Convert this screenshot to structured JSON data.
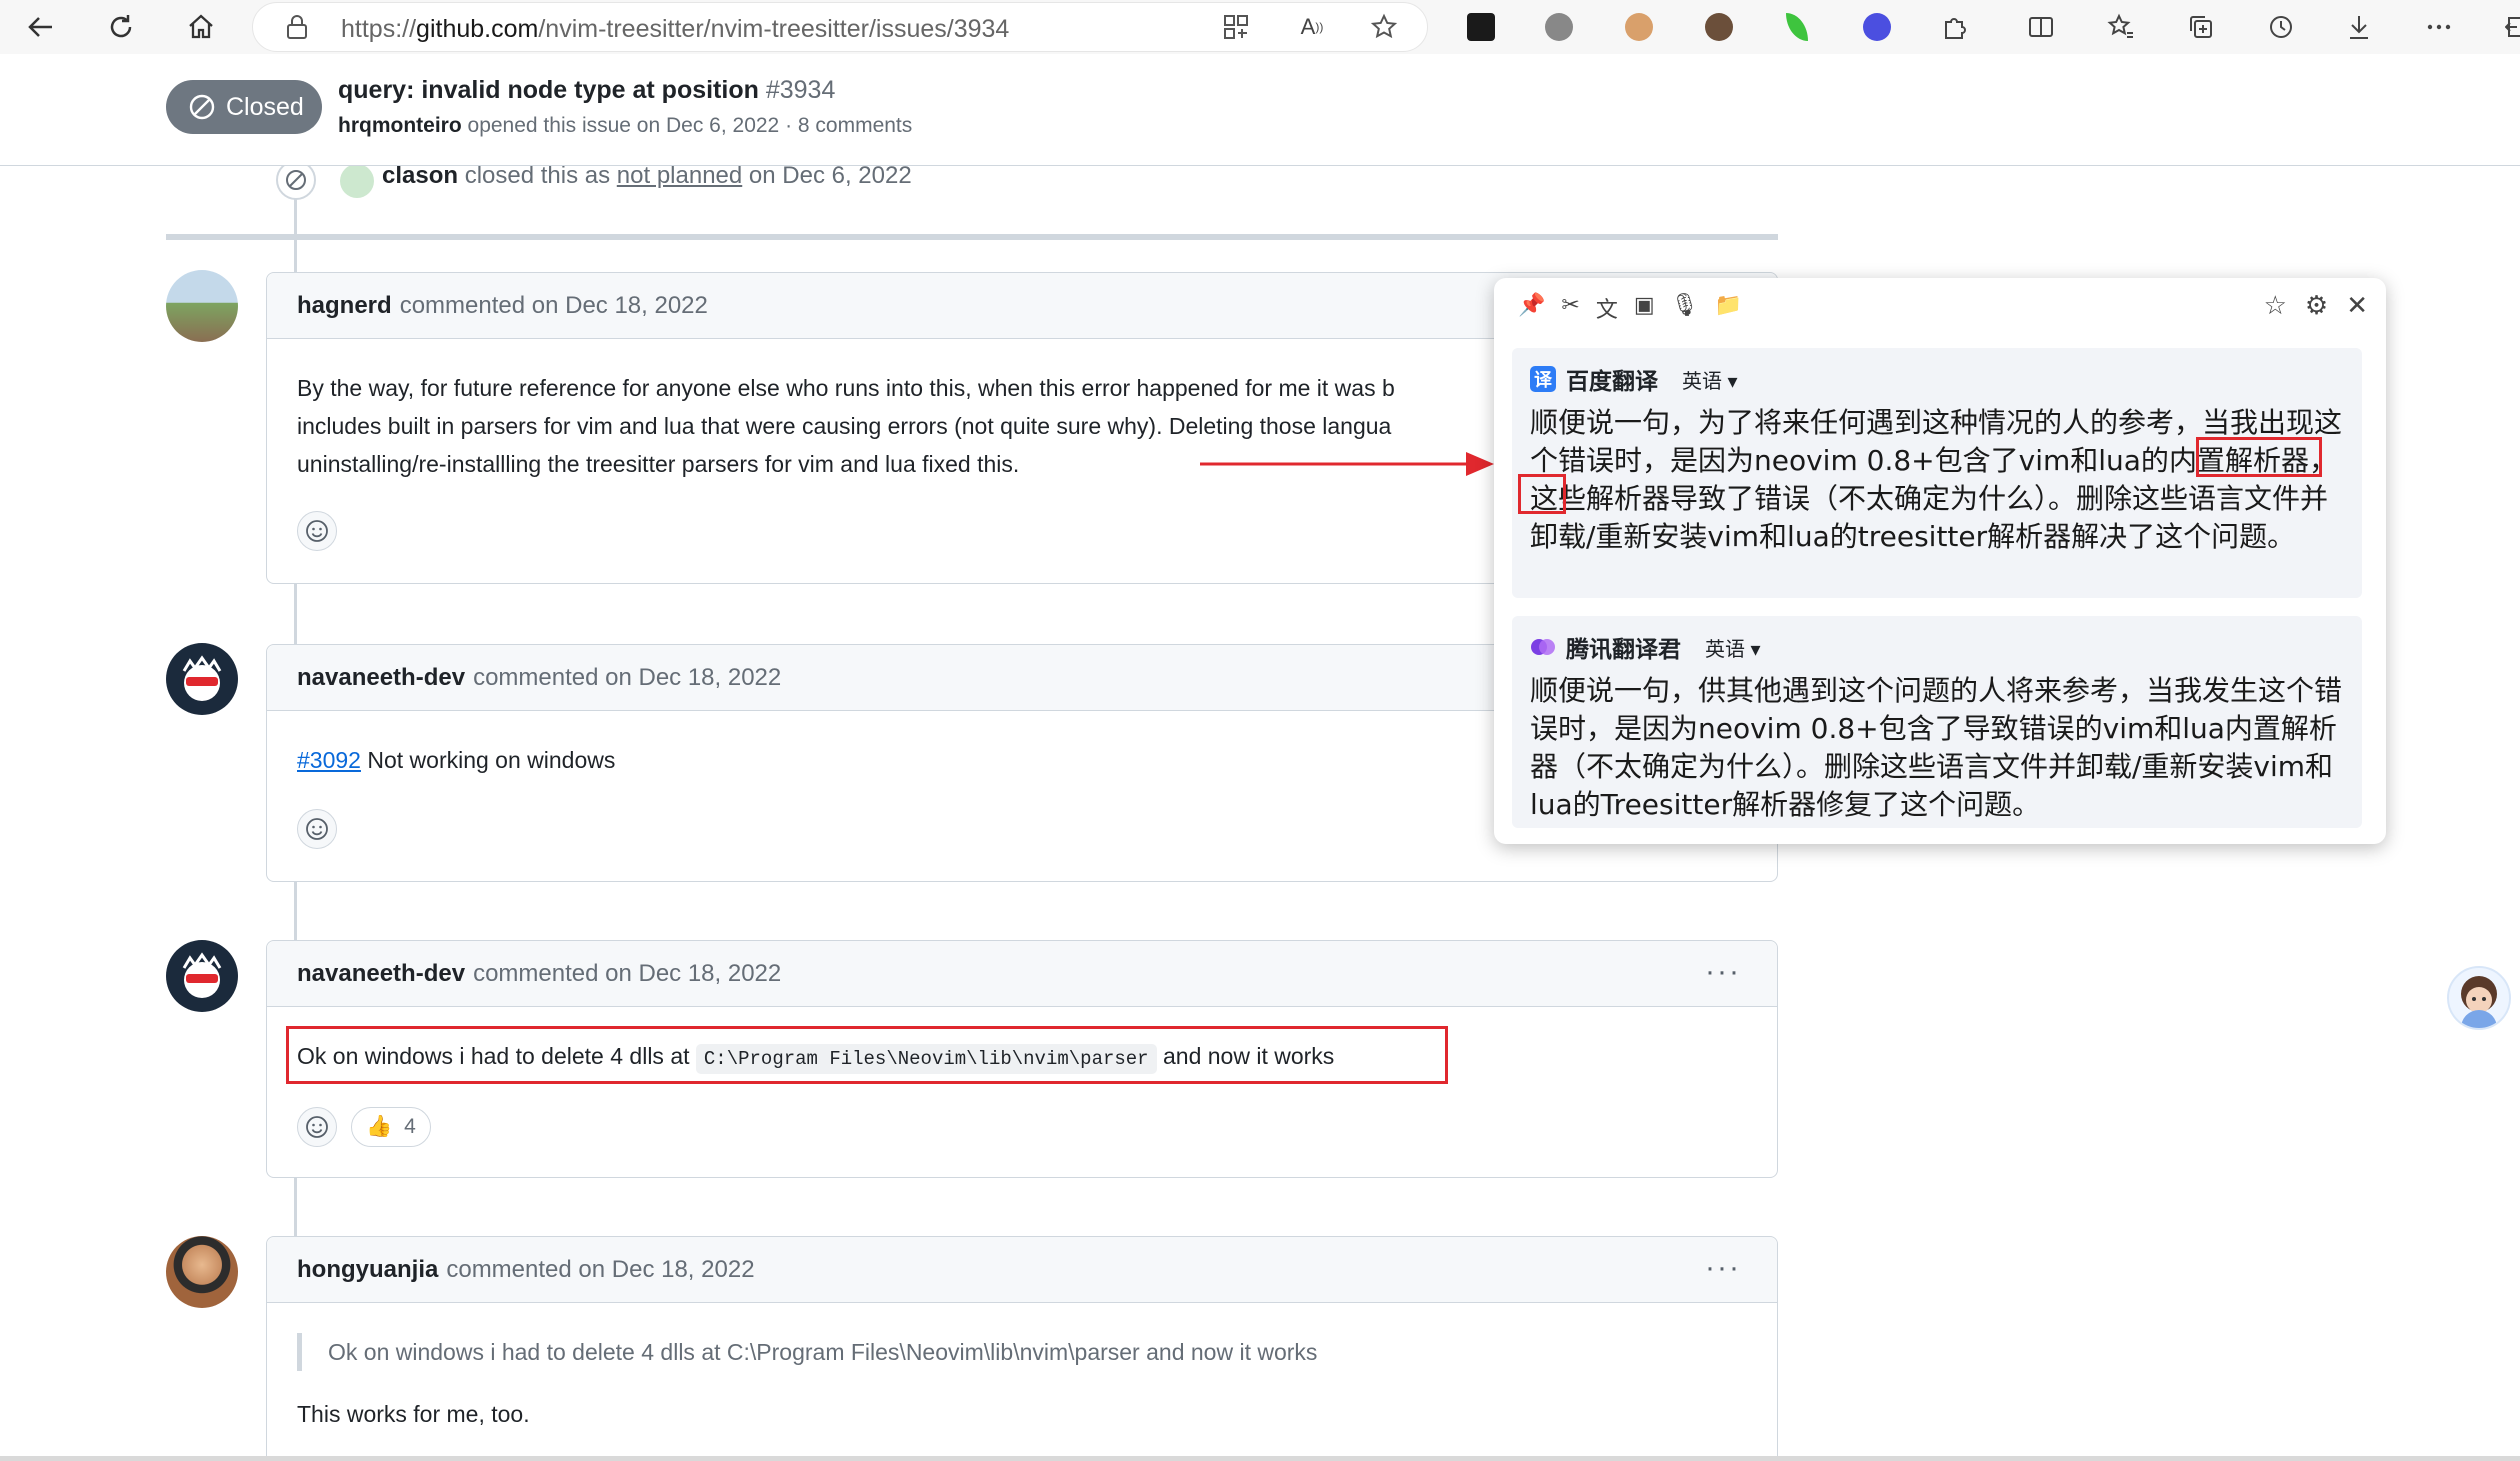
{
  "browser": {
    "url_prefix": "https://",
    "url_host": "github.com",
    "url_path": "/nvim-treesitter/nvim-treesitter/issues/3934"
  },
  "issue": {
    "state": "Closed",
    "title": "query: invalid node type at position",
    "number": "#3934",
    "author": "hrqmonteiro",
    "opened_text": "opened this issue on Dec 6, 2022 · 8 comments"
  },
  "close_event": {
    "user": "clason",
    "text_before": "closed this as",
    "reason": "not planned",
    "text_after": "on Dec 6, 2022"
  },
  "comments": [
    {
      "author": "hagnerd",
      "meta": "commented on Dec 18, 2022",
      "lines": [
        "By the way, for future reference for anyone else who runs into this, when this error happened for me it was b",
        "includes built in parsers for vim and lua that were causing errors (not quite sure why). Deleting those langua",
        "uninstalling/re-installling the treesitter parsers for vim and lua fixed this."
      ]
    },
    {
      "author": "navaneeth-dev",
      "meta": "commented on Dec 18, 2022",
      "link": "#3092",
      "text": "Not working on windows"
    },
    {
      "author": "navaneeth-dev",
      "meta": "commented on Dec 18, 2022",
      "text_before": "Ok on windows i had to delete 4 dlls at",
      "code": "C:\\Program Files\\Neovim\\lib\\nvim\\parser",
      "text_after": "and now it works",
      "reaction_count": "4"
    },
    {
      "author": "hongyuanjia",
      "meta": "commented on Dec 18, 2022",
      "quote": "Ok on windows i had to delete 4 dlls at C:\\Program Files\\Neovim\\lib\\nvim\\parser and now it works",
      "text": "This works for me, too."
    }
  ],
  "translation": {
    "baidu": {
      "name": "百度翻译",
      "lang": "英语",
      "text_a": "顺便说一句，为了将来任何遇到这种情况的人的参考，当我出现这个错误时，是因为neovim 0.8+包含了vim和lua的",
      "text_highlight": "内置解析器",
      "text_b": "，这些解析器导致了错误（不太确定为什么）。删除这些语言文件并卸载/重新安装vim和lua的treesitter解析器解决了这个问题。"
    },
    "tencent": {
      "name": "腾讯翻译君",
      "lang": "英语",
      "text": "顺便说一句，供其他遇到这个问题的人将来参考，当我发生这个错误时，是因为neovim 0.8+包含了导致错误的vim和lua内置解析器（不太确定为什么）。删除这些语言文件并卸载/重新安装vim和lua的Treesitter解析器修复了这个问题。"
    }
  },
  "colors": {
    "closed_badge": "#6e7781",
    "highlight_red": "#e0282e",
    "link_blue": "#0969da",
    "baidu_blue": "#2d7cf6"
  }
}
